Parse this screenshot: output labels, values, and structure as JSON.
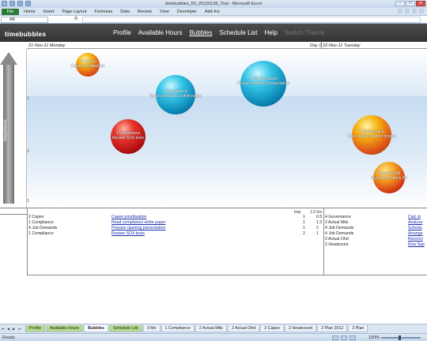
{
  "window": {
    "title": "timebubbles_50_20120128_Trial - Microsoft Excel",
    "minimize": "–",
    "restore": "□",
    "close": "✕"
  },
  "ribbon": {
    "file_label": "File",
    "tabs": [
      "Home",
      "Insert",
      "Page Layout",
      "Formulas",
      "Data",
      "Review",
      "View",
      "Developer",
      "Add-Ins"
    ]
  },
  "formula": {
    "namebox": "A8",
    "fx": "fx",
    "value": ""
  },
  "app": {
    "brand": "timebubbles",
    "nav": [
      "Profile",
      "Available Hours",
      "Bubbles",
      "Schedule List",
      "Help",
      "Switch Theme"
    ],
    "active": "Bubbles"
  },
  "days": {
    "day1": "21-Nov-11 Monday",
    "day_num": "Day 1",
    "day2": "22-Nov-11 Tuesday"
  },
  "axis": {
    "label": "Importance",
    "ticks": [
      "1",
      "2",
      "3"
    ]
  },
  "bubbles": [
    {
      "line1": "2 Capex",
      "line2": "Capex prioritisation",
      "color": "orange"
    },
    {
      "line1": "1 Compliance",
      "line2": "Read compliance white paper",
      "color": "blue"
    },
    {
      "line1": "4 Job Demands",
      "line2": "Prepare opening presentation",
      "color": "blue"
    },
    {
      "line1": "1 Compliance",
      "line2": "Review SOX tests",
      "color": "red"
    },
    {
      "line1": "4 Governance",
      "line2": "Ops standardisation impact",
      "color": "orange"
    },
    {
      "line1": "2 Actual Ohd",
      "line2": "Reconcile Ohd in Wi",
      "color": "orangered"
    }
  ],
  "table": {
    "headers": {
      "imp": "Imp",
      "slots": "1.5 hrs"
    },
    "left_rows": [
      {
        "cat": "2 Capex",
        "task": "Capex prioritisation",
        "imp": "1",
        "hrs": "0.5"
      },
      {
        "cat": "1 Compliance",
        "task": "Read compliance white paper",
        "imp": "1",
        "hrs": "1.5"
      },
      {
        "cat": "4 Job Demands",
        "task": "Prepare opening presentation",
        "imp": "1",
        "hrs": "2"
      },
      {
        "cat": "1 Compliance",
        "task": "Review SOX tests",
        "imp": "2",
        "hrs": "1"
      }
    ],
    "right_rows": [
      {
        "cat": "4 Governance",
        "task": "Calc st"
      },
      {
        "cat": "2 Actual Mtls",
        "task": "Analyse"
      },
      {
        "cat": "4 Job Demands",
        "task": "Schedu"
      },
      {
        "cat": "4 Job Demands",
        "task": "Arrange"
      },
      {
        "cat": "2 Actual Ohd",
        "task": "Reconci"
      },
      {
        "cat": "2 Headcount",
        "task": "Rvw Sep"
      }
    ]
  },
  "sheettabs": [
    "Profile",
    "Available Hours",
    "Bubbles",
    "Schedule List",
    "3 Me",
    "1 Compliance",
    "2 Actual Mtls",
    "2 Actual Ohd",
    "2 Capex",
    "2 Headcount",
    "2 Plan 2012",
    "2 Plan"
  ],
  "status": {
    "left": "Ready",
    "zoom": "100%"
  }
}
